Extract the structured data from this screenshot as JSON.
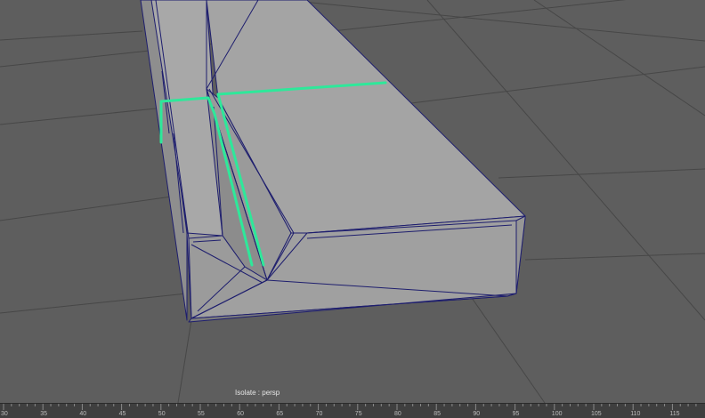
{
  "viewport": {
    "camera_label": "Isolate : persp",
    "colors": {
      "background": "#5e5e5e",
      "grid": "#4a4a4a",
      "mesh_face": "#a3a3a3",
      "mesh_wire": "#1e1e6e",
      "selected_edges": "#2ee89a"
    }
  },
  "timeline": {
    "tick_labels": [
      "30",
      "35",
      "40",
      "45",
      "50",
      "55",
      "60",
      "65",
      "70",
      "75",
      "80",
      "85",
      "90",
      "95",
      "100",
      "105",
      "110",
      "115"
    ]
  }
}
